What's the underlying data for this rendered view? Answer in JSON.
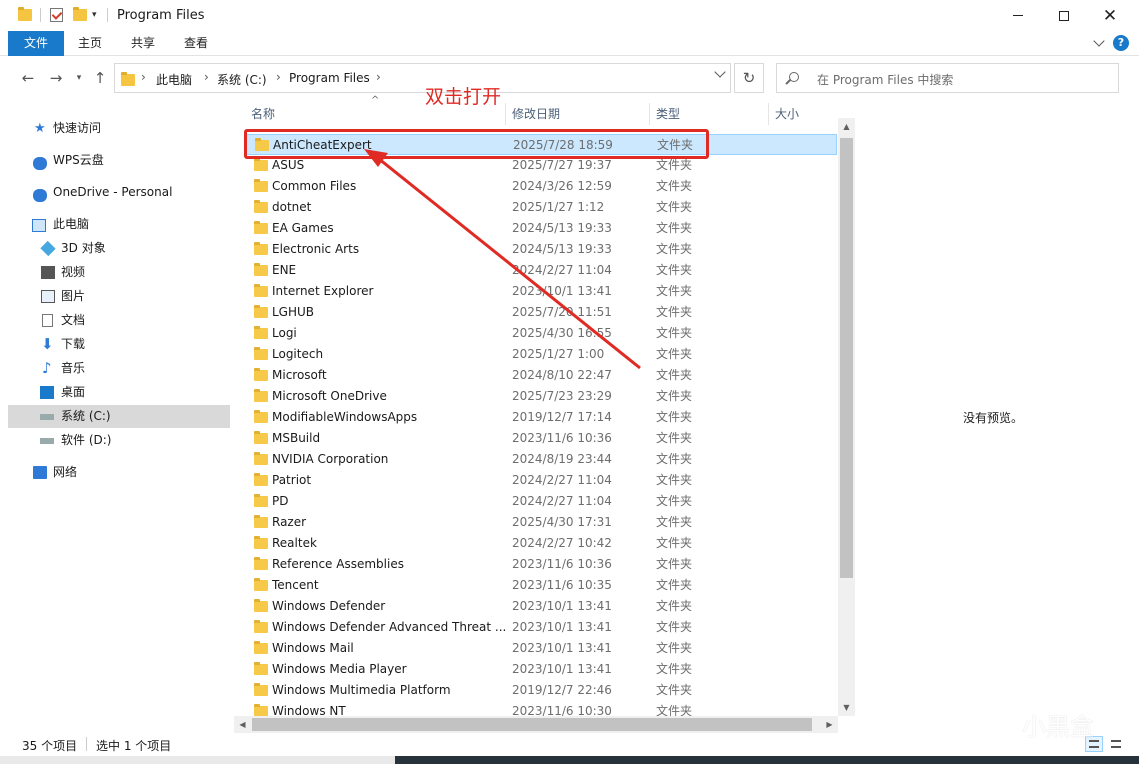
{
  "window": {
    "title": "Program Files"
  },
  "ribbon": {
    "tabs": [
      "文件",
      "主页",
      "共享",
      "查看"
    ]
  },
  "address": {
    "crumbs": [
      "此电脑",
      "系统 (C:)",
      "Program Files"
    ],
    "search_placeholder": "在 Program Files 中搜索"
  },
  "sidebar": {
    "items": [
      {
        "label": "快速访问",
        "icon": "star-icon"
      },
      {
        "label": "WPS云盘",
        "icon": "cloud-icon"
      },
      {
        "label": "OneDrive - Personal",
        "icon": "cloud-icon"
      },
      {
        "label": "此电脑",
        "icon": "computer-icon"
      },
      {
        "label": "3D 对象",
        "icon": "cube-icon"
      },
      {
        "label": "视频",
        "icon": "video-icon"
      },
      {
        "label": "图片",
        "icon": "picture-icon"
      },
      {
        "label": "文档",
        "icon": "document-icon"
      },
      {
        "label": "下载",
        "icon": "download-icon"
      },
      {
        "label": "音乐",
        "icon": "music-icon"
      },
      {
        "label": "桌面",
        "icon": "desktop-icon"
      },
      {
        "label": "系统 (C:)",
        "icon": "drive-icon",
        "selected": true
      },
      {
        "label": "软件 (D:)",
        "icon": "drive-icon"
      },
      {
        "label": "网络",
        "icon": "network-icon"
      }
    ]
  },
  "columns": {
    "name": "名称",
    "date": "修改日期",
    "type": "类型",
    "size": "大小"
  },
  "files": [
    {
      "name": "AntiCheatExpert",
      "date": "2025/7/28 18:59",
      "type": "文件夹",
      "selected": true
    },
    {
      "name": "ASUS",
      "date": "2025/7/27 19:37",
      "type": "文件夹"
    },
    {
      "name": "Common Files",
      "date": "2024/3/26 12:59",
      "type": "文件夹"
    },
    {
      "name": "dotnet",
      "date": "2025/1/27 1:12",
      "type": "文件夹"
    },
    {
      "name": "EA Games",
      "date": "2024/5/13 19:33",
      "type": "文件夹"
    },
    {
      "name": "Electronic Arts",
      "date": "2024/5/13 19:33",
      "type": "文件夹"
    },
    {
      "name": "ENE",
      "date": "2024/2/27 11:04",
      "type": "文件夹"
    },
    {
      "name": "Internet Explorer",
      "date": "2023/10/1 13:41",
      "type": "文件夹"
    },
    {
      "name": "LGHUB",
      "date": "2025/7/20 11:51",
      "type": "文件夹"
    },
    {
      "name": "Logi",
      "date": "2025/4/30 16:55",
      "type": "文件夹"
    },
    {
      "name": "Logitech",
      "date": "2025/1/27 1:00",
      "type": "文件夹"
    },
    {
      "name": "Microsoft",
      "date": "2024/8/10 22:47",
      "type": "文件夹"
    },
    {
      "name": "Microsoft OneDrive",
      "date": "2025/7/23 23:29",
      "type": "文件夹"
    },
    {
      "name": "ModifiableWindowsApps",
      "date": "2019/12/7 17:14",
      "type": "文件夹"
    },
    {
      "name": "MSBuild",
      "date": "2023/11/6 10:36",
      "type": "文件夹"
    },
    {
      "name": "NVIDIA Corporation",
      "date": "2024/8/19 23:44",
      "type": "文件夹"
    },
    {
      "name": "Patriot",
      "date": "2024/2/27 11:04",
      "type": "文件夹"
    },
    {
      "name": "PD",
      "date": "2024/2/27 11:04",
      "type": "文件夹"
    },
    {
      "name": "Razer",
      "date": "2025/4/30 17:31",
      "type": "文件夹"
    },
    {
      "name": "Realtek",
      "date": "2024/2/27 10:42",
      "type": "文件夹"
    },
    {
      "name": "Reference Assemblies",
      "date": "2023/11/6 10:36",
      "type": "文件夹"
    },
    {
      "name": "Tencent",
      "date": "2023/11/6 10:35",
      "type": "文件夹"
    },
    {
      "name": "Windows Defender",
      "date": "2023/10/1 13:41",
      "type": "文件夹"
    },
    {
      "name": "Windows Defender Advanced Threat ...",
      "date": "2023/10/1 13:41",
      "type": "文件夹"
    },
    {
      "name": "Windows Mail",
      "date": "2023/10/1 13:41",
      "type": "文件夹"
    },
    {
      "name": "Windows Media Player",
      "date": "2023/10/1 13:41",
      "type": "文件夹"
    },
    {
      "name": "Windows Multimedia Platform",
      "date": "2019/12/7 22:46",
      "type": "文件夹"
    },
    {
      "name": "Windows NT",
      "date": "2023/11/6 10:30",
      "type": "文件夹"
    }
  ],
  "preview": {
    "empty_text": "没有预览。"
  },
  "status": {
    "count": "35 个项目",
    "selection": "选中 1 个项目"
  },
  "annotation": {
    "text": "双击打开",
    "color": "#e02b24"
  },
  "watermark": {
    "text": "小黑盒"
  },
  "colors": {
    "accent": "#1979ca",
    "selection": "#cce8ff"
  }
}
